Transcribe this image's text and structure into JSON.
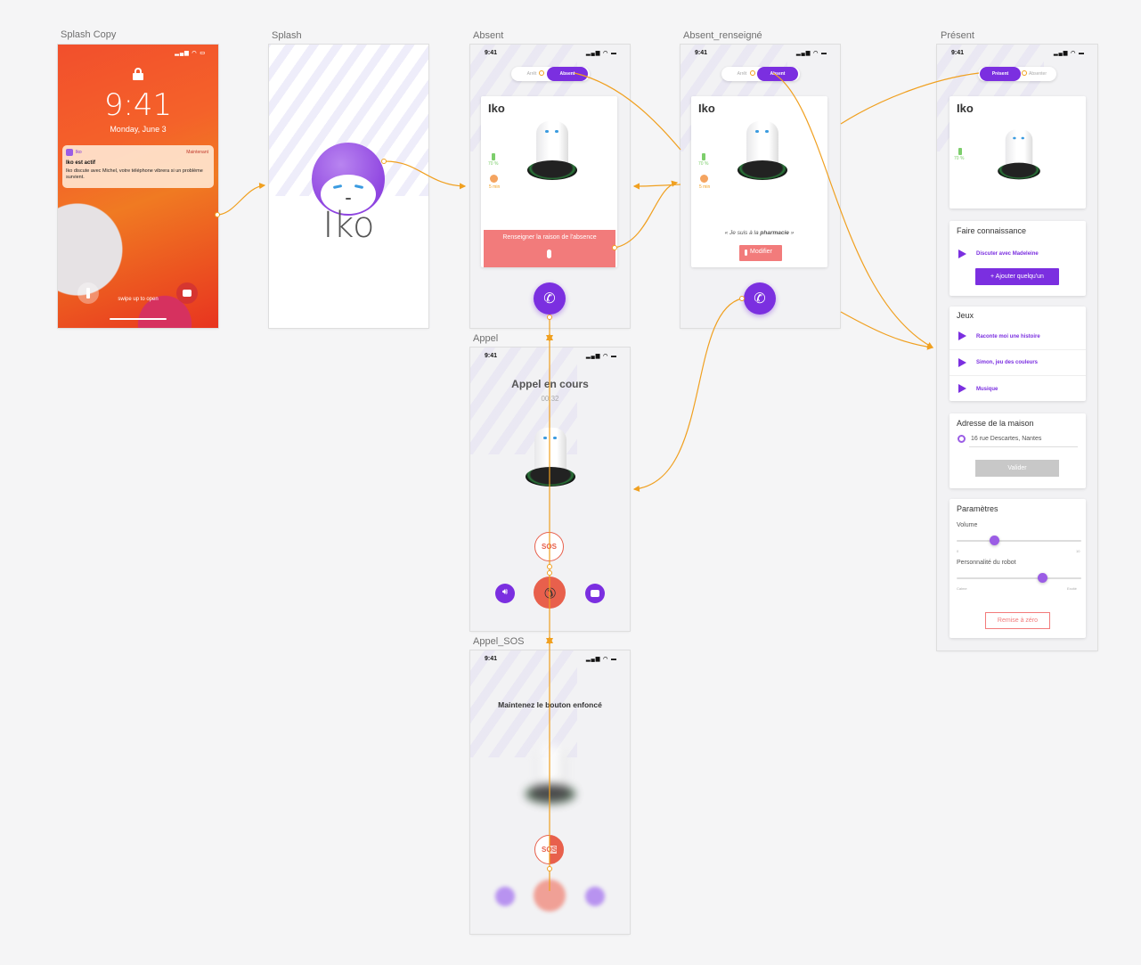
{
  "titles": {
    "splash_copy": "Splash Copy",
    "splash": "Splash",
    "absent": "Absent",
    "absent_renseigne": "Absent_renseigné",
    "present": "Présent",
    "appel": "Appel",
    "appel_sos": "Appel_SOS"
  },
  "status_time": "9:41",
  "lock": {
    "time": "9:41",
    "date": "Monday, June 3",
    "notif_app": "Iko",
    "notif_when": "Maintenant",
    "notif_title": "Iko est actif",
    "notif_body": "Iko discute avec Michel, votre téléphone vibrera si un problème survient.",
    "swipe": "swipe up to open"
  },
  "splash": {
    "brand": "Iko"
  },
  "absent": {
    "toggle_left": "Arrêt",
    "toggle_active": "Absent",
    "robot_name": "Iko",
    "battery": "70 %",
    "timer": "5 min",
    "banner": "Renseigner la raison de l'absence"
  },
  "absent_renseigne": {
    "toggle_left": "Arrêt",
    "toggle_active": "Absent",
    "robot_name": "Iko",
    "battery": "70 %",
    "timer": "5 min",
    "quote_prefix": "« Je suis à la ",
    "quote_place": "pharmacie",
    "quote_suffix": " »",
    "modify": "Modifier"
  },
  "present": {
    "toggle_active": "Présent",
    "toggle_right": "Absenter",
    "robot_name": "Iko",
    "battery": "70 %",
    "meet_title": "Faire connaissance",
    "meet_item": "Discuter avec Madeleine",
    "add_btn": "+ Ajouter quelqu'un",
    "games_title": "Jeux",
    "games": [
      "Raconte moi une histoire",
      "Simon, jeu des couleurs",
      "Musique"
    ],
    "address_title": "Adresse de la maison",
    "address": "16 rue Descartes, Nantes",
    "validate": "Valider",
    "params_title": "Paramètres",
    "volume_label": "Volume",
    "volume_min": "0",
    "volume_max": "10",
    "volume_value": 3,
    "perso_label": "Personnalité du robot",
    "perso_min": "Calme",
    "perso_max": "Excité",
    "perso_value": 0.69,
    "reset": "Remise à zéro"
  },
  "appel": {
    "title": "Appel en cours",
    "duration": "00:32",
    "sos": "SOS"
  },
  "appel_sos": {
    "instruction": "Maintenez le bouton enfoncé",
    "sos": "SOS"
  },
  "colors": {
    "purple": "#7b2fe0",
    "red": "#e8604c",
    "arrow": "#f0a020"
  }
}
